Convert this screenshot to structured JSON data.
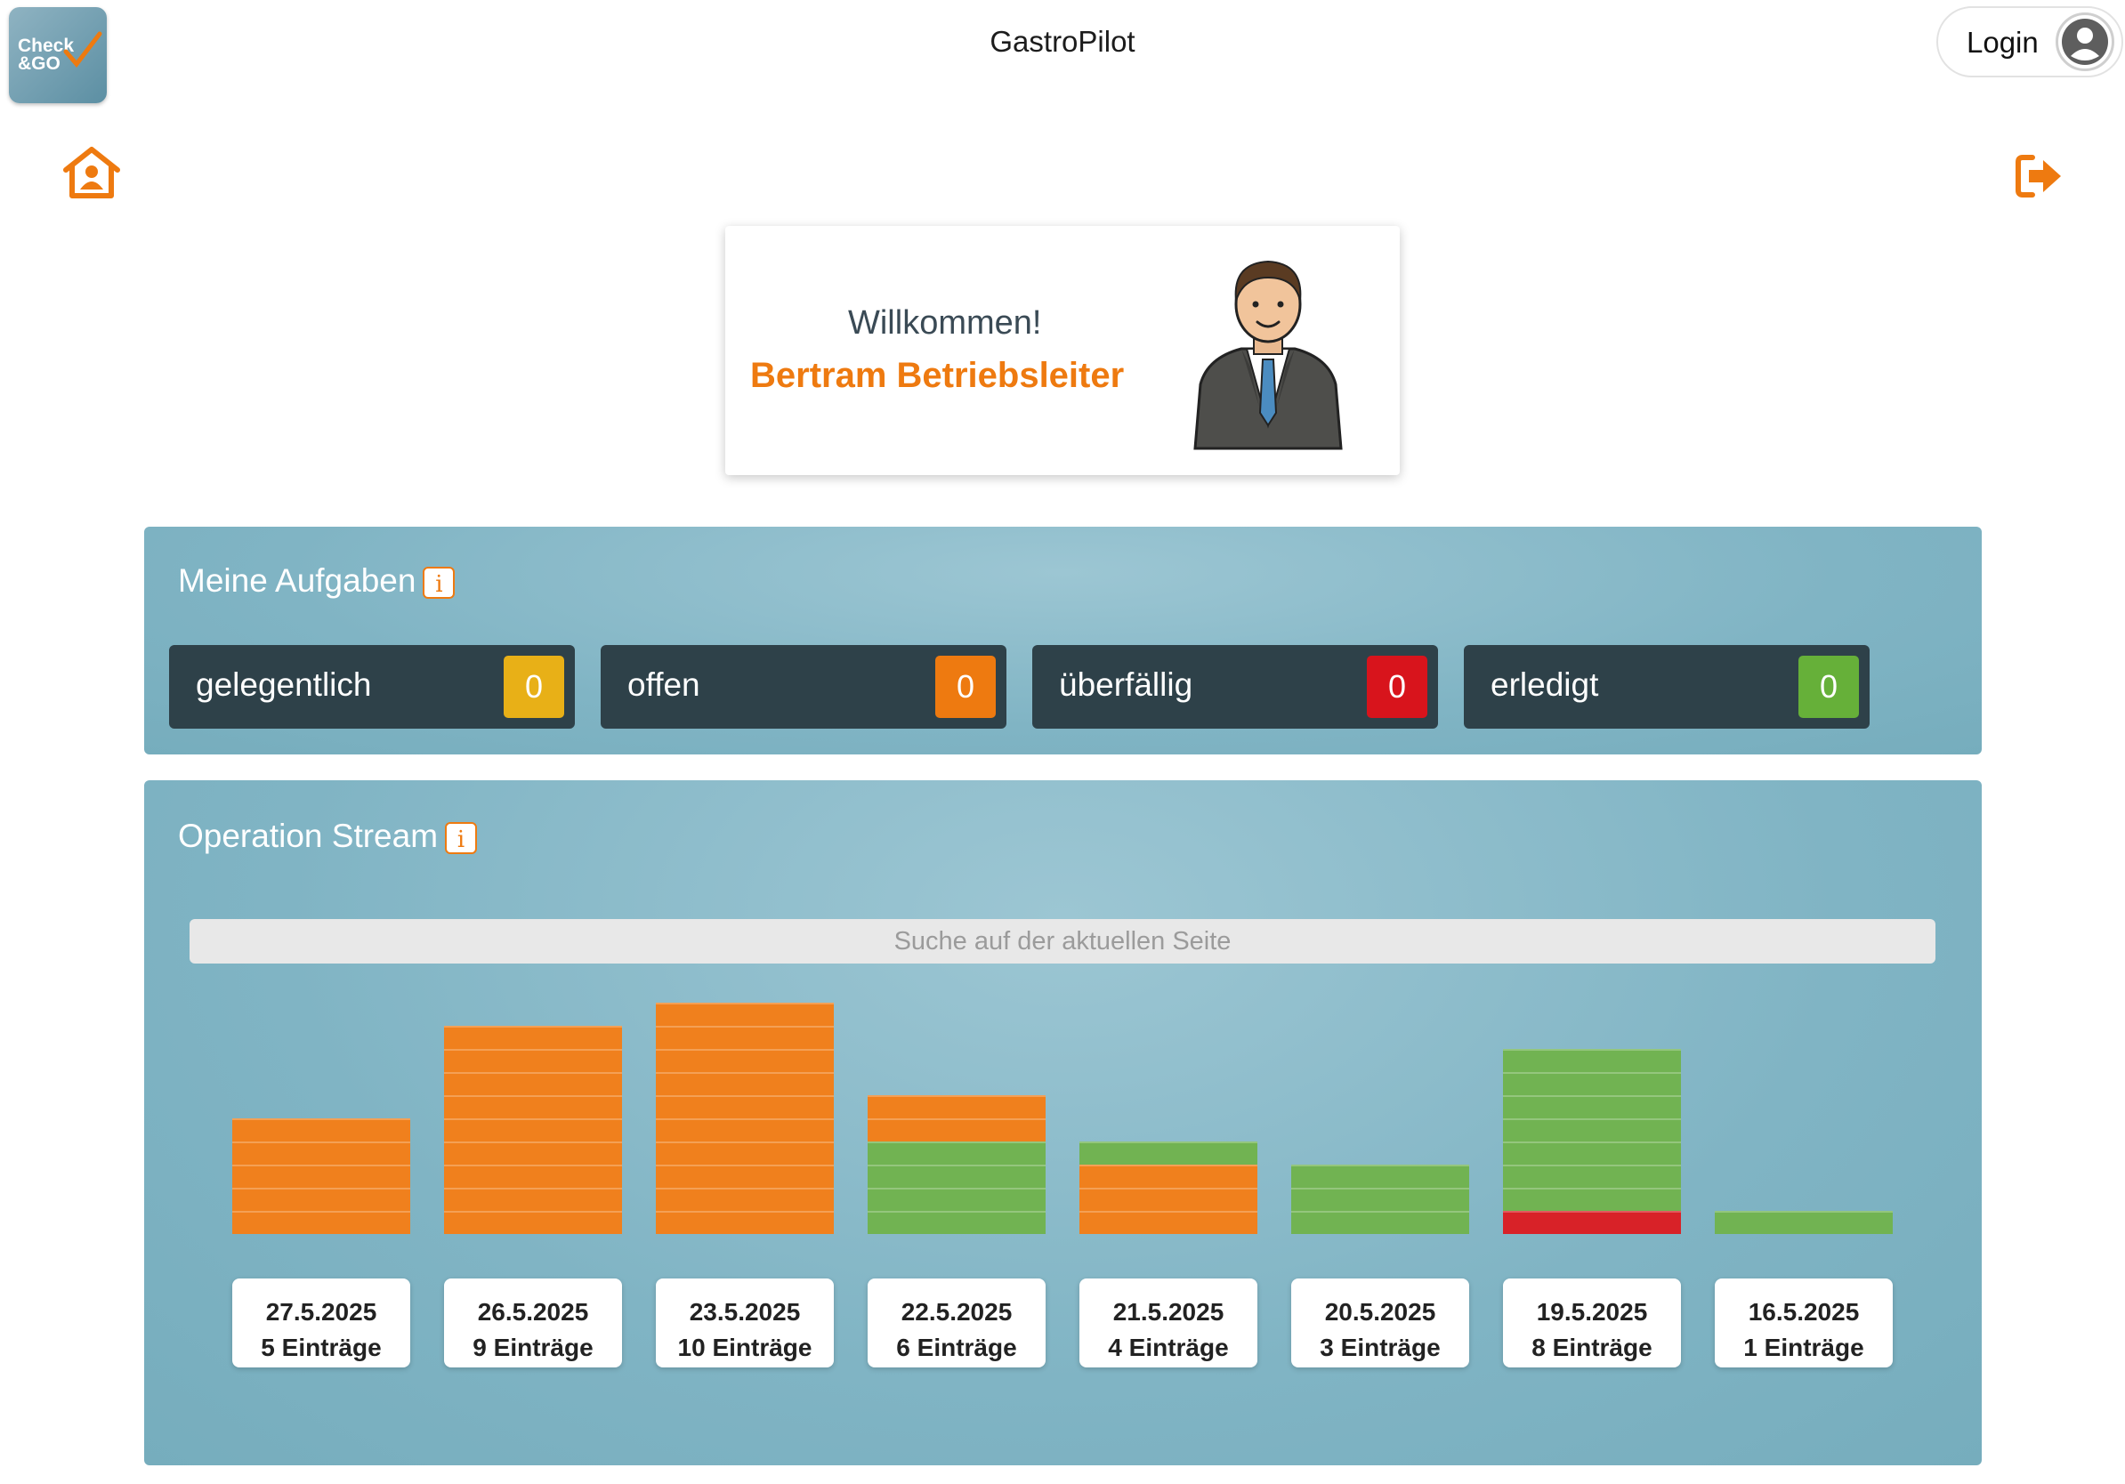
{
  "logo": {
    "line1": "Check",
    "line2": "&GO"
  },
  "header": {
    "title": "GastroPilot",
    "login_label": "Login"
  },
  "welcome": {
    "greeting": "Willkommen!",
    "name": "Bertram Betriebsleiter"
  },
  "tasks": {
    "title": "Meine Aufgaben",
    "info": "i",
    "items": [
      {
        "label": "gelegentlich",
        "count": "0",
        "color": "#e8b017"
      },
      {
        "label": "offen",
        "count": "0",
        "color": "#ee7a10"
      },
      {
        "label": "überfällig",
        "count": "0",
        "color": "#d8141c"
      },
      {
        "label": "erledigt",
        "count": "0",
        "color": "#66b039"
      }
    ]
  },
  "stream": {
    "title": "Operation Stream",
    "info": "i",
    "search_placeholder": "Suche auf der aktuellen Seite",
    "colors": {
      "orange": "#f0801d",
      "green": "#71b352",
      "red": "#d82228"
    },
    "days": [
      {
        "date": "27.5.2025",
        "entries": "5 Einträge",
        "segments": [
          "orange",
          "orange",
          "orange",
          "orange",
          "orange"
        ]
      },
      {
        "date": "26.5.2025",
        "entries": "9 Einträge",
        "segments": [
          "orange",
          "orange",
          "orange",
          "orange",
          "orange",
          "orange",
          "orange",
          "orange",
          "orange"
        ]
      },
      {
        "date": "23.5.2025",
        "entries": "10 Einträge",
        "segments": [
          "orange",
          "orange",
          "orange",
          "orange",
          "orange",
          "orange",
          "orange",
          "orange",
          "orange",
          "orange"
        ]
      },
      {
        "date": "22.5.2025",
        "entries": "6 Einträge",
        "segments": [
          "green",
          "green",
          "green",
          "green",
          "orange",
          "orange"
        ]
      },
      {
        "date": "21.5.2025",
        "entries": "4 Einträge",
        "segments": [
          "orange",
          "orange",
          "orange",
          "green"
        ]
      },
      {
        "date": "20.5.2025",
        "entries": "3 Einträge",
        "segments": [
          "green",
          "green",
          "green"
        ]
      },
      {
        "date": "19.5.2025",
        "entries": "8 Einträge",
        "segments": [
          "red",
          "green",
          "green",
          "green",
          "green",
          "green",
          "green",
          "green"
        ]
      },
      {
        "date": "16.5.2025",
        "entries": "1 Einträge",
        "segments": [
          "green"
        ]
      }
    ]
  }
}
